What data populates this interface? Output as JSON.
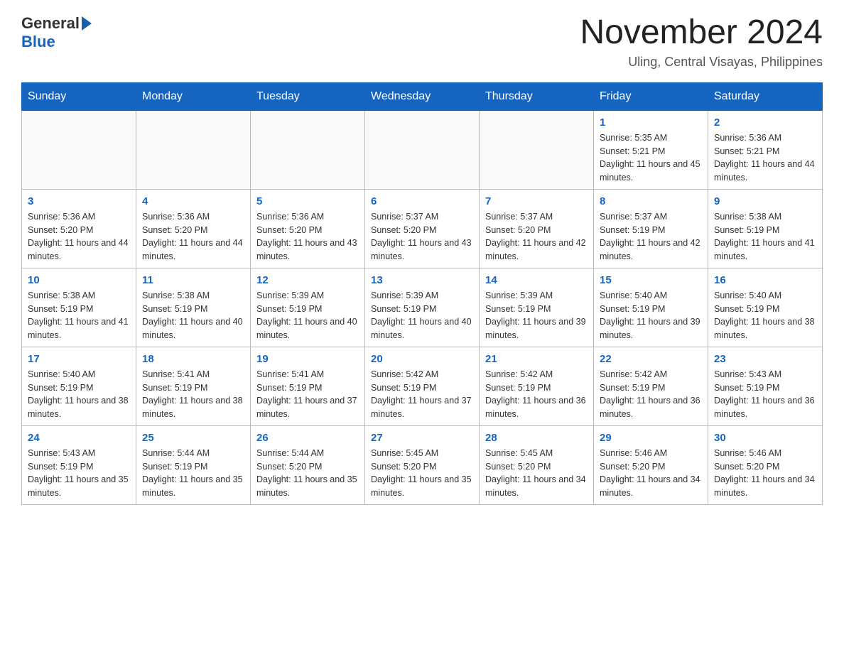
{
  "header": {
    "logo_general": "General",
    "logo_blue": "Blue",
    "month_title": "November 2024",
    "location": "Uling, Central Visayas, Philippines"
  },
  "calendar": {
    "days_of_week": [
      "Sunday",
      "Monday",
      "Tuesday",
      "Wednesday",
      "Thursday",
      "Friday",
      "Saturday"
    ],
    "weeks": [
      [
        {
          "day": "",
          "info": ""
        },
        {
          "day": "",
          "info": ""
        },
        {
          "day": "",
          "info": ""
        },
        {
          "day": "",
          "info": ""
        },
        {
          "day": "",
          "info": ""
        },
        {
          "day": "1",
          "info": "Sunrise: 5:35 AM\nSunset: 5:21 PM\nDaylight: 11 hours and 45 minutes."
        },
        {
          "day": "2",
          "info": "Sunrise: 5:36 AM\nSunset: 5:21 PM\nDaylight: 11 hours and 44 minutes."
        }
      ],
      [
        {
          "day": "3",
          "info": "Sunrise: 5:36 AM\nSunset: 5:20 PM\nDaylight: 11 hours and 44 minutes."
        },
        {
          "day": "4",
          "info": "Sunrise: 5:36 AM\nSunset: 5:20 PM\nDaylight: 11 hours and 44 minutes."
        },
        {
          "day": "5",
          "info": "Sunrise: 5:36 AM\nSunset: 5:20 PM\nDaylight: 11 hours and 43 minutes."
        },
        {
          "day": "6",
          "info": "Sunrise: 5:37 AM\nSunset: 5:20 PM\nDaylight: 11 hours and 43 minutes."
        },
        {
          "day": "7",
          "info": "Sunrise: 5:37 AM\nSunset: 5:20 PM\nDaylight: 11 hours and 42 minutes."
        },
        {
          "day": "8",
          "info": "Sunrise: 5:37 AM\nSunset: 5:19 PM\nDaylight: 11 hours and 42 minutes."
        },
        {
          "day": "9",
          "info": "Sunrise: 5:38 AM\nSunset: 5:19 PM\nDaylight: 11 hours and 41 minutes."
        }
      ],
      [
        {
          "day": "10",
          "info": "Sunrise: 5:38 AM\nSunset: 5:19 PM\nDaylight: 11 hours and 41 minutes."
        },
        {
          "day": "11",
          "info": "Sunrise: 5:38 AM\nSunset: 5:19 PM\nDaylight: 11 hours and 40 minutes."
        },
        {
          "day": "12",
          "info": "Sunrise: 5:39 AM\nSunset: 5:19 PM\nDaylight: 11 hours and 40 minutes."
        },
        {
          "day": "13",
          "info": "Sunrise: 5:39 AM\nSunset: 5:19 PM\nDaylight: 11 hours and 40 minutes."
        },
        {
          "day": "14",
          "info": "Sunrise: 5:39 AM\nSunset: 5:19 PM\nDaylight: 11 hours and 39 minutes."
        },
        {
          "day": "15",
          "info": "Sunrise: 5:40 AM\nSunset: 5:19 PM\nDaylight: 11 hours and 39 minutes."
        },
        {
          "day": "16",
          "info": "Sunrise: 5:40 AM\nSunset: 5:19 PM\nDaylight: 11 hours and 38 minutes."
        }
      ],
      [
        {
          "day": "17",
          "info": "Sunrise: 5:40 AM\nSunset: 5:19 PM\nDaylight: 11 hours and 38 minutes."
        },
        {
          "day": "18",
          "info": "Sunrise: 5:41 AM\nSunset: 5:19 PM\nDaylight: 11 hours and 38 minutes."
        },
        {
          "day": "19",
          "info": "Sunrise: 5:41 AM\nSunset: 5:19 PM\nDaylight: 11 hours and 37 minutes."
        },
        {
          "day": "20",
          "info": "Sunrise: 5:42 AM\nSunset: 5:19 PM\nDaylight: 11 hours and 37 minutes."
        },
        {
          "day": "21",
          "info": "Sunrise: 5:42 AM\nSunset: 5:19 PM\nDaylight: 11 hours and 36 minutes."
        },
        {
          "day": "22",
          "info": "Sunrise: 5:42 AM\nSunset: 5:19 PM\nDaylight: 11 hours and 36 minutes."
        },
        {
          "day": "23",
          "info": "Sunrise: 5:43 AM\nSunset: 5:19 PM\nDaylight: 11 hours and 36 minutes."
        }
      ],
      [
        {
          "day": "24",
          "info": "Sunrise: 5:43 AM\nSunset: 5:19 PM\nDaylight: 11 hours and 35 minutes."
        },
        {
          "day": "25",
          "info": "Sunrise: 5:44 AM\nSunset: 5:19 PM\nDaylight: 11 hours and 35 minutes."
        },
        {
          "day": "26",
          "info": "Sunrise: 5:44 AM\nSunset: 5:20 PM\nDaylight: 11 hours and 35 minutes."
        },
        {
          "day": "27",
          "info": "Sunrise: 5:45 AM\nSunset: 5:20 PM\nDaylight: 11 hours and 35 minutes."
        },
        {
          "day": "28",
          "info": "Sunrise: 5:45 AM\nSunset: 5:20 PM\nDaylight: 11 hours and 34 minutes."
        },
        {
          "day": "29",
          "info": "Sunrise: 5:46 AM\nSunset: 5:20 PM\nDaylight: 11 hours and 34 minutes."
        },
        {
          "day": "30",
          "info": "Sunrise: 5:46 AM\nSunset: 5:20 PM\nDaylight: 11 hours and 34 minutes."
        }
      ]
    ]
  }
}
